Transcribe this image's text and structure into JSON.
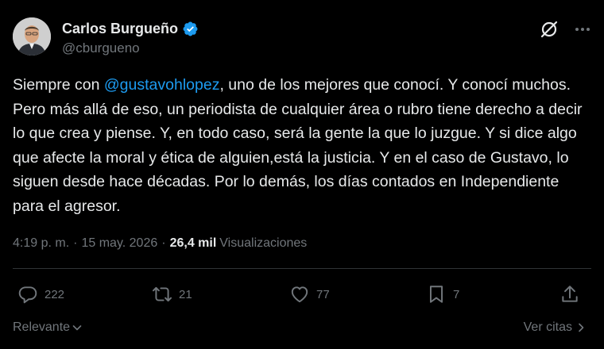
{
  "author": {
    "name": "Carlos Burgueño",
    "handle": "@cburgueno"
  },
  "tweet": {
    "text_before_mention": "Siempre con ",
    "mention": "@gustavohlopez",
    "text_after_mention": ", uno de los mejores que conocí. Y conocí muchos. Pero más allá de eso, un periodista de cualquier área o rubro tiene derecho a decir lo que crea y piense. Y, en todo caso, será la gente la que lo juzgue. Y si dice algo que afecte la moral y ética de alguien,está la justicia. Y en el caso de Gustavo, lo siguen desde hace décadas. Por lo demás, los días contados en Independiente para el agresor."
  },
  "meta": {
    "time": "4:19 p. m.",
    "separator": "·",
    "date": "15 may. 2026",
    "views_count": "26,4 mil",
    "views_label": "Visualizaciones"
  },
  "actions": {
    "replies": "222",
    "reposts": "21",
    "likes": "77",
    "bookmarks": "7"
  },
  "footer": {
    "sort_label": "Relevante",
    "quotes_label": "Ver citas"
  },
  "colors": {
    "background": "#000000",
    "text": "#e7e9ea",
    "muted": "#71767b",
    "accent": "#1d9bf0"
  },
  "icons": [
    "verified-badge-icon",
    "grok-icon",
    "more-icon",
    "reply-icon",
    "repost-icon",
    "like-icon",
    "bookmark-icon",
    "share-icon",
    "chevron-down-icon",
    "chevron-right-icon"
  ]
}
